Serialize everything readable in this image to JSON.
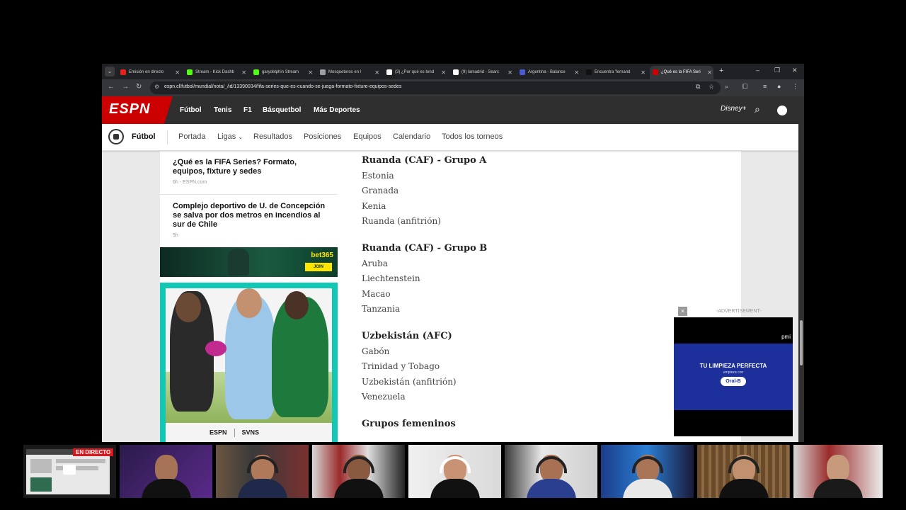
{
  "colors": {
    "espn_red": "#cc0000",
    "espn_dark": "#2f2f2f",
    "chrome_dark": "#202124",
    "teal": "#12c7b3",
    "bet_yellow": "#ffe500",
    "ad_blue": "#1d2f9a",
    "live_red": "#d71920"
  },
  "browser": {
    "tabs": [
      {
        "label": "Emisión en directo",
        "icon": "youtube-icon",
        "color": "#e62117"
      },
      {
        "label": "Stream - Kick Dashb",
        "icon": "kick-icon",
        "color": "#53fc18"
      },
      {
        "label": "garydelphin Stream",
        "icon": "kick-icon",
        "color": "#53fc18"
      },
      {
        "label": "Mosqueteros en l",
        "icon": "globe-icon",
        "color": "#9aa0a6"
      },
      {
        "label": "(3) ¿Por qué es tend",
        "icon": "x-icon",
        "color": "#ffffff"
      },
      {
        "label": "(9) lamadrid - Searc",
        "icon": "x-icon",
        "color": "#ffffff"
      },
      {
        "label": "Argentina - Balance",
        "icon": "generic-icon",
        "color": "#4a5bd1"
      },
      {
        "label": "Encuentra 'fernand",
        "icon": "tiktok-icon",
        "color": "#111111"
      },
      {
        "label": "¿Qué es la FIFA Seri",
        "icon": "espn-icon",
        "color": "#cc0000"
      }
    ],
    "url": "espn.cl/futbol/mundial/nota/_/id/13390034/fifa-series-que-es-cuando-se-juega-formato-fixture-equipos-sedes"
  },
  "espn": {
    "logo": "ESPN",
    "nav": [
      "Fútbol",
      "Tenis",
      "F1",
      "Básquetbol",
      "Más Deportes"
    ],
    "disney": "Disney+"
  },
  "subnav": {
    "title": "Fútbol",
    "links": [
      "Portada",
      "Ligas",
      "Resultados",
      "Posiciones",
      "Equipos",
      "Calendario",
      "Todos los torneos"
    ]
  },
  "sidebar": {
    "news": [
      {
        "title": "¿Qué es la FIFA Series? Formato, equipos, fixture y sedes",
        "meta": "6h  - ESPN.com"
      },
      {
        "title": "Complejo deportivo de U. de Concepción se salva por dos metros en incendios al sur de Chile",
        "meta": "5h"
      }
    ],
    "ad": {
      "brand": "bet365",
      "cta": "JOIN"
    },
    "promo": {
      "logo1": "ESPN",
      "logo2": "SVNS"
    }
  },
  "article": {
    "groups": [
      {
        "title": "Ruanda (CAF) - Grupo A",
        "items": [
          "Estonia",
          "Granada",
          "Kenia",
          "Ruanda (anfitrión)"
        ]
      },
      {
        "title": "Ruanda (CAF) - Grupo B",
        "items": [
          "Aruba",
          "Liechtenstein",
          "Macao",
          "Tanzania"
        ]
      },
      {
        "title": "Uzbekistán (AFC)",
        "items": [
          "Gabón",
          "Trinidad y Tobago",
          "Uzbekistán (anfitrión)",
          "Venezuela"
        ]
      },
      {
        "title": "Grupos femeninos",
        "items": []
      }
    ]
  },
  "video_ad": {
    "label": "-ADVERTISEMENT-",
    "close": "×",
    "brand": "pmi",
    "headline": "TU LIMPIEZA PERFECTA",
    "sub": "empieza con",
    "product": "Oral-B"
  },
  "call": {
    "live_label": "EN DIRECTO"
  }
}
